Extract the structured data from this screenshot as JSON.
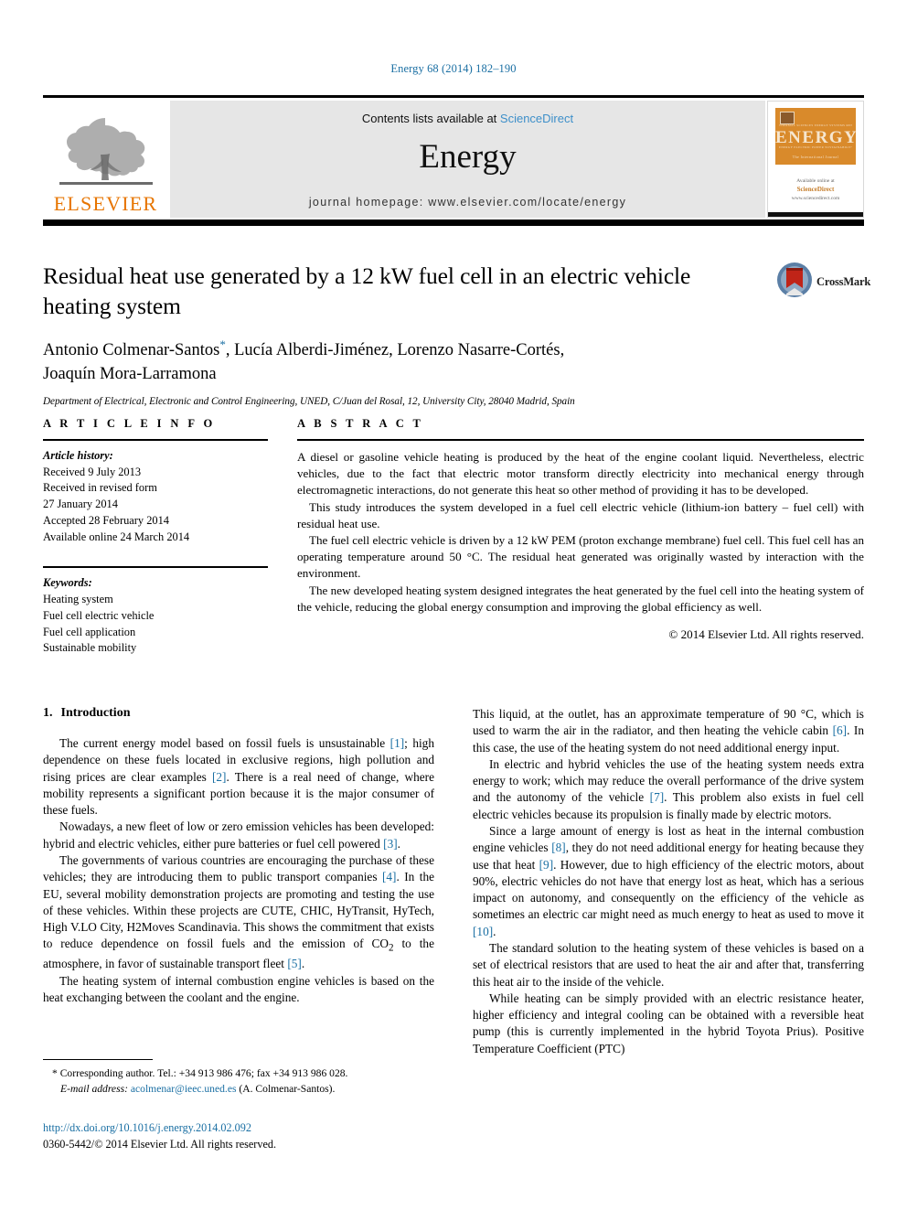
{
  "running_head": "Energy 68 (2014) 182–190",
  "masthead": {
    "publisher_logo_label": "ELSEVIER",
    "contents_prefix": "Contents lists available at ",
    "sciencedirect": "ScienceDirect",
    "journal_name": "Energy",
    "homepage": "journal homepage: www.elsevier.com/locate/energy",
    "cover": {
      "title": "ENERGY",
      "microtop": "The International Journal",
      "micro_row": "THERMAL SCIENCES   ENERGY SYSTEMS   RENEWABLE   POLICY",
      "micro_row2": "ENERGY     ELECTRIC POWER     SUSTAINABILITY     FUELS",
      "publisher_line": "Available online at",
      "sd_name": "ScienceDirect",
      "sd_url": "www.sciencedirect.com"
    },
    "accent_blue": "#3d8fc9",
    "elsevier_orange": "#E77500"
  },
  "article": {
    "title": "Residual heat use generated by a 12 kW fuel cell in an electric vehicle heating system",
    "authors": "Antonio Colmenar-Santos*, Lucía Alberdi-Jiménez, Lorenzo Nasarre-Cortés, Joaquín Mora-Larramona",
    "authors_line1": "Antonio Colmenar-Santos",
    "authors_line1_rest": ", Lucía Alberdi-Jiménez, Lorenzo Nasarre-Cortés,",
    "corresponding_marker": "*",
    "authors_line2": "Joaquín Mora-Larramona",
    "affiliation": "Department of Electrical, Electronic and Control Engineering, UNED, C/Juan del Rosal, 12, University City, 28040 Madrid, Spain",
    "crossmark_label": "CrossMark"
  },
  "article_info": {
    "heading": "A R T I C L E   I N F O",
    "history_label": "Article history:",
    "history": [
      "Received 9 July 2013",
      "Received in revised form",
      "27 January 2014",
      "Accepted 28 February 2014",
      "Available online 24 March 2014"
    ],
    "keywords_label": "Keywords:",
    "keywords": [
      "Heating system",
      "Fuel cell electric vehicle",
      "Fuel cell application",
      "Sustainable mobility"
    ]
  },
  "abstract": {
    "heading": "A B S T R A C T",
    "paragraphs": [
      "A diesel or gasoline vehicle heating is produced by the heat of the engine coolant liquid. Nevertheless, electric vehicles, due to the fact that electric motor transform directly electricity into mechanical energy through electromagnetic interactions, do not generate this heat so other method of providing it has to be developed.",
      "This study introduces the system developed in a fuel cell electric vehicle (lithium-ion battery – fuel cell) with residual heat use.",
      "The fuel cell electric vehicle is driven by a 12 kW PEM (proton exchange membrane) fuel cell. This fuel cell has an operating temperature around 50 °C. The residual heat generated was originally wasted by interaction with the environment.",
      "The new developed heating system designed integrates the heat generated by the fuel cell into the heating system of the vehicle, reducing the global energy consumption and improving the global efficiency as well."
    ],
    "copyright": "© 2014 Elsevier Ltd. All rights reserved."
  },
  "body": {
    "section_number": "1.",
    "section_title": "Introduction",
    "left_column": [
      {
        "indent": true,
        "segments": [
          {
            "t": "The current energy model based on fossil fuels is unsustainable "
          },
          {
            "t": "[1]",
            "ref": true
          },
          {
            "t": "; high dependence on these fuels located in exclusive regions, high pollution and rising prices are clear examples "
          },
          {
            "t": "[2]",
            "ref": true
          },
          {
            "t": ". There is a real need of change, where mobility represents a significant portion because it is the major consumer of these fuels."
          }
        ]
      },
      {
        "indent": true,
        "segments": [
          {
            "t": "Nowadays, a new fleet of low or zero emission vehicles has been developed: hybrid and electric vehicles, either pure batteries or fuel cell powered "
          },
          {
            "t": "[3]",
            "ref": true
          },
          {
            "t": "."
          }
        ]
      },
      {
        "indent": true,
        "segments": [
          {
            "t": "The governments of various countries are encouraging the purchase of these vehicles; they are introducing them to public transport companies "
          },
          {
            "t": "[4]",
            "ref": true
          },
          {
            "t": ". In the EU, several mobility demonstration projects are promoting and testing the use of these vehicles. Within these projects are CUTE, CHIC, HyTransit, HyTech, High V.LO City, H2Moves Scandinavia. This shows the commitment that exists to reduce dependence on fossil fuels and the emission of CO"
          },
          {
            "t": "2",
            "sub": true
          },
          {
            "t": " to the atmosphere, in favor of sustainable transport fleet "
          },
          {
            "t": "[5]",
            "ref": true
          },
          {
            "t": "."
          }
        ]
      },
      {
        "indent": true,
        "segments": [
          {
            "t": "The heating system of internal combustion engine vehicles is based on the heat exchanging between the coolant and the engine."
          }
        ]
      }
    ],
    "right_column": [
      {
        "indent": false,
        "segments": [
          {
            "t": "This liquid, at the outlet, has an approximate temperature of 90 °C, which is used to warm the air in the radiator, and then heating the vehicle cabin "
          },
          {
            "t": "[6]",
            "ref": true
          },
          {
            "t": ". In this case, the use of the heating system do not need additional energy input."
          }
        ]
      },
      {
        "indent": true,
        "segments": [
          {
            "t": "In electric and hybrid vehicles the use of the heating system needs extra energy to work; which may reduce the overall performance of the drive system and the autonomy of the vehicle "
          },
          {
            "t": "[7]",
            "ref": true
          },
          {
            "t": ". This problem also exists in fuel cell electric vehicles because its propulsion is finally made by electric motors."
          }
        ]
      },
      {
        "indent": true,
        "segments": [
          {
            "t": "Since a large amount of energy is lost as heat in the internal combustion engine vehicles "
          },
          {
            "t": "[8]",
            "ref": true
          },
          {
            "t": ", they do not need additional energy for heating because they use that heat "
          },
          {
            "t": "[9]",
            "ref": true
          },
          {
            "t": ". However, due to high efficiency of the electric motors, about 90%, electric vehicles do not have that energy lost as heat, which has a serious impact on autonomy, and consequently on the efficiency of the vehicle as sometimes an electric car might need as much energy to heat as used to move it "
          },
          {
            "t": "[10]",
            "ref": true
          },
          {
            "t": "."
          }
        ]
      },
      {
        "indent": true,
        "segments": [
          {
            "t": "The standard solution to the heating system of these vehicles is based on a set of electrical resistors that are used to heat the air and after that, transferring this heat air to the inside of the vehicle."
          }
        ]
      },
      {
        "indent": true,
        "segments": [
          {
            "t": "While heating can be simply provided with an electric resistance heater, higher efficiency and integral cooling can be obtained with a reversible heat pump (this is currently implemented in the hybrid Toyota Prius). Positive Temperature Coefficient (PTC)"
          }
        ]
      }
    ]
  },
  "footnote": {
    "marker": "*",
    "corresponding": " Corresponding author. Tel.: +34 913 986 476; fax +34 913 986 028.",
    "email_label": "E-mail address:",
    "email": "acolmenar@ieec.uned.es",
    "email_suffix": " (A. Colmenar-Santos)."
  },
  "publication": {
    "doi": "http://dx.doi.org/10.1016/j.energy.2014.02.092",
    "issn_line": "0360-5442/© 2014 Elsevier Ltd. All rights reserved."
  }
}
